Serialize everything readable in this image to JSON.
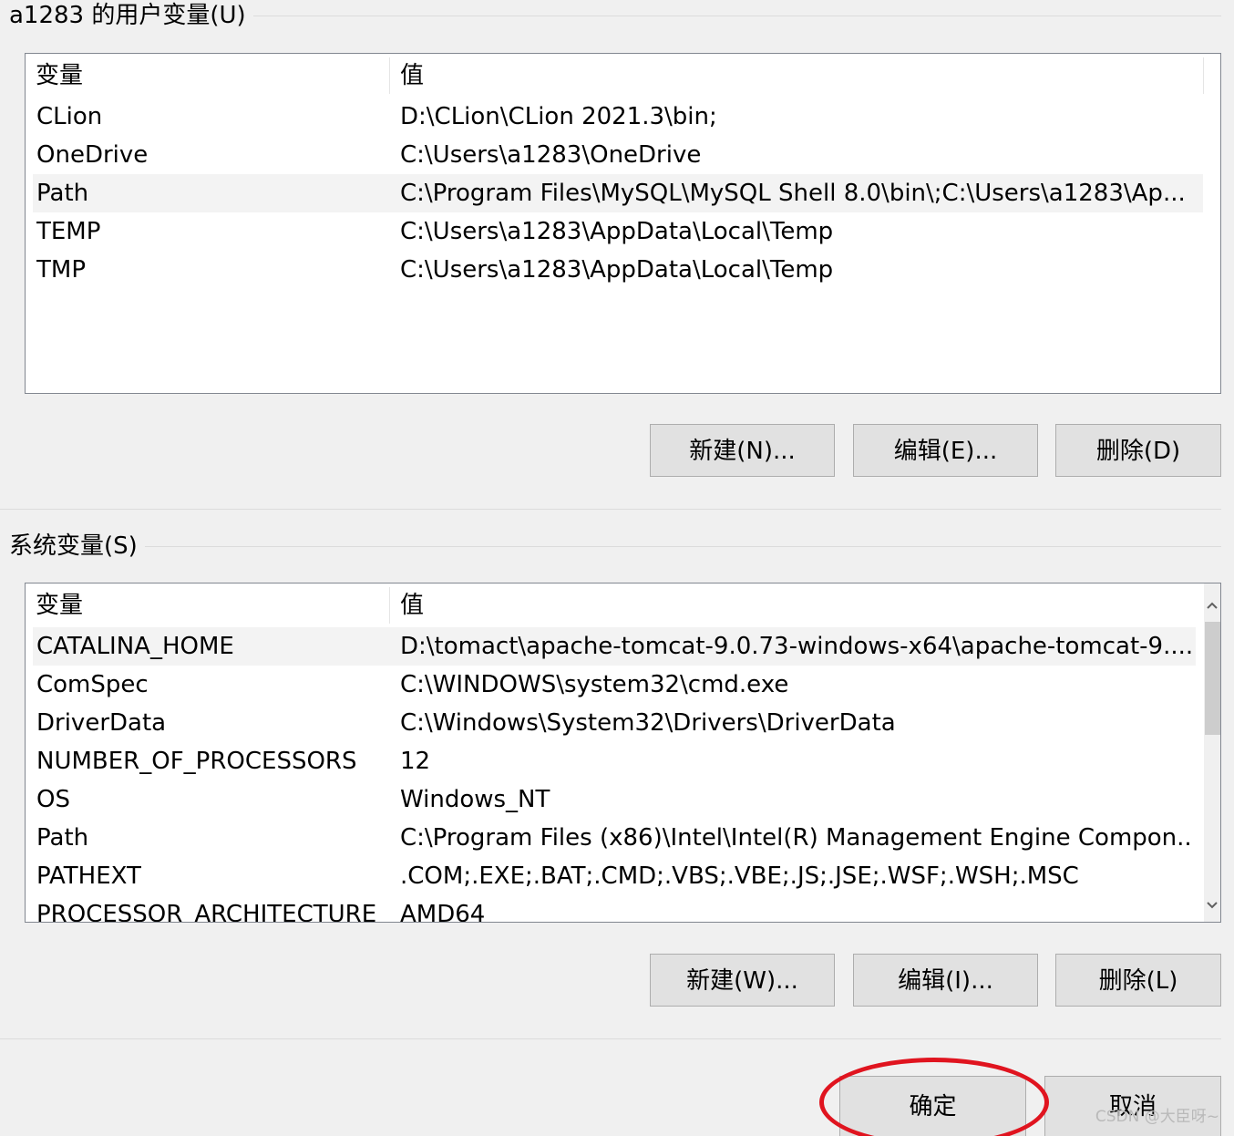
{
  "user_vars": {
    "group_title": "a1283 的用户变量(U)",
    "col_name": "变量",
    "col_value": "值",
    "rows": [
      {
        "name": "CLion",
        "value": "D:\\CLion\\CLion 2021.3\\bin;"
      },
      {
        "name": "OneDrive",
        "value": "C:\\Users\\a1283\\OneDrive"
      },
      {
        "name": "Path",
        "value": "C:\\Program Files\\MySQL\\MySQL Shell 8.0\\bin\\;C:\\Users\\a1283\\Ap..."
      },
      {
        "name": "TEMP",
        "value": "C:\\Users\\a1283\\AppData\\Local\\Temp"
      },
      {
        "name": "TMP",
        "value": "C:\\Users\\a1283\\AppData\\Local\\Temp"
      }
    ],
    "selected_row": 2,
    "buttons": {
      "new": "新建(N)...",
      "edit": "编辑(E)...",
      "delete": "删除(D)"
    }
  },
  "system_vars": {
    "group_title": "系统变量(S)",
    "col_name": "变量",
    "col_value": "值",
    "rows": [
      {
        "name": "CATALINA_HOME",
        "value": "D:\\tomact\\apache-tomcat-9.0.73-windows-x64\\apache-tomcat-9...."
      },
      {
        "name": "ComSpec",
        "value": "C:\\WINDOWS\\system32\\cmd.exe"
      },
      {
        "name": "DriverData",
        "value": "C:\\Windows\\System32\\Drivers\\DriverData"
      },
      {
        "name": "NUMBER_OF_PROCESSORS",
        "value": "12"
      },
      {
        "name": "OS",
        "value": "Windows_NT"
      },
      {
        "name": "Path",
        "value": "C:\\Program Files (x86)\\Intel\\Intel(R) Management Engine Compon..."
      },
      {
        "name": "PATHEXT",
        "value": ".COM;.EXE;.BAT;.CMD;.VBS;.VBE;.JS;.JSE;.WSF;.WSH;.MSC"
      },
      {
        "name": "PROCESSOR_ARCHITECTURE",
        "value": "AMD64"
      }
    ],
    "selected_row": 0,
    "buttons": {
      "new": "新建(W)...",
      "edit": "编辑(I)...",
      "delete": "删除(L)"
    }
  },
  "dialog_buttons": {
    "ok": "确定",
    "cancel": "取消"
  },
  "watermark": "CSDN @大臣呀~",
  "colors": {
    "annotation": "#e0141f",
    "selected_row": "#f3f3f3"
  },
  "icons": {
    "scroll_up": "chevron-up-icon",
    "scroll_down": "chevron-down-icon"
  }
}
